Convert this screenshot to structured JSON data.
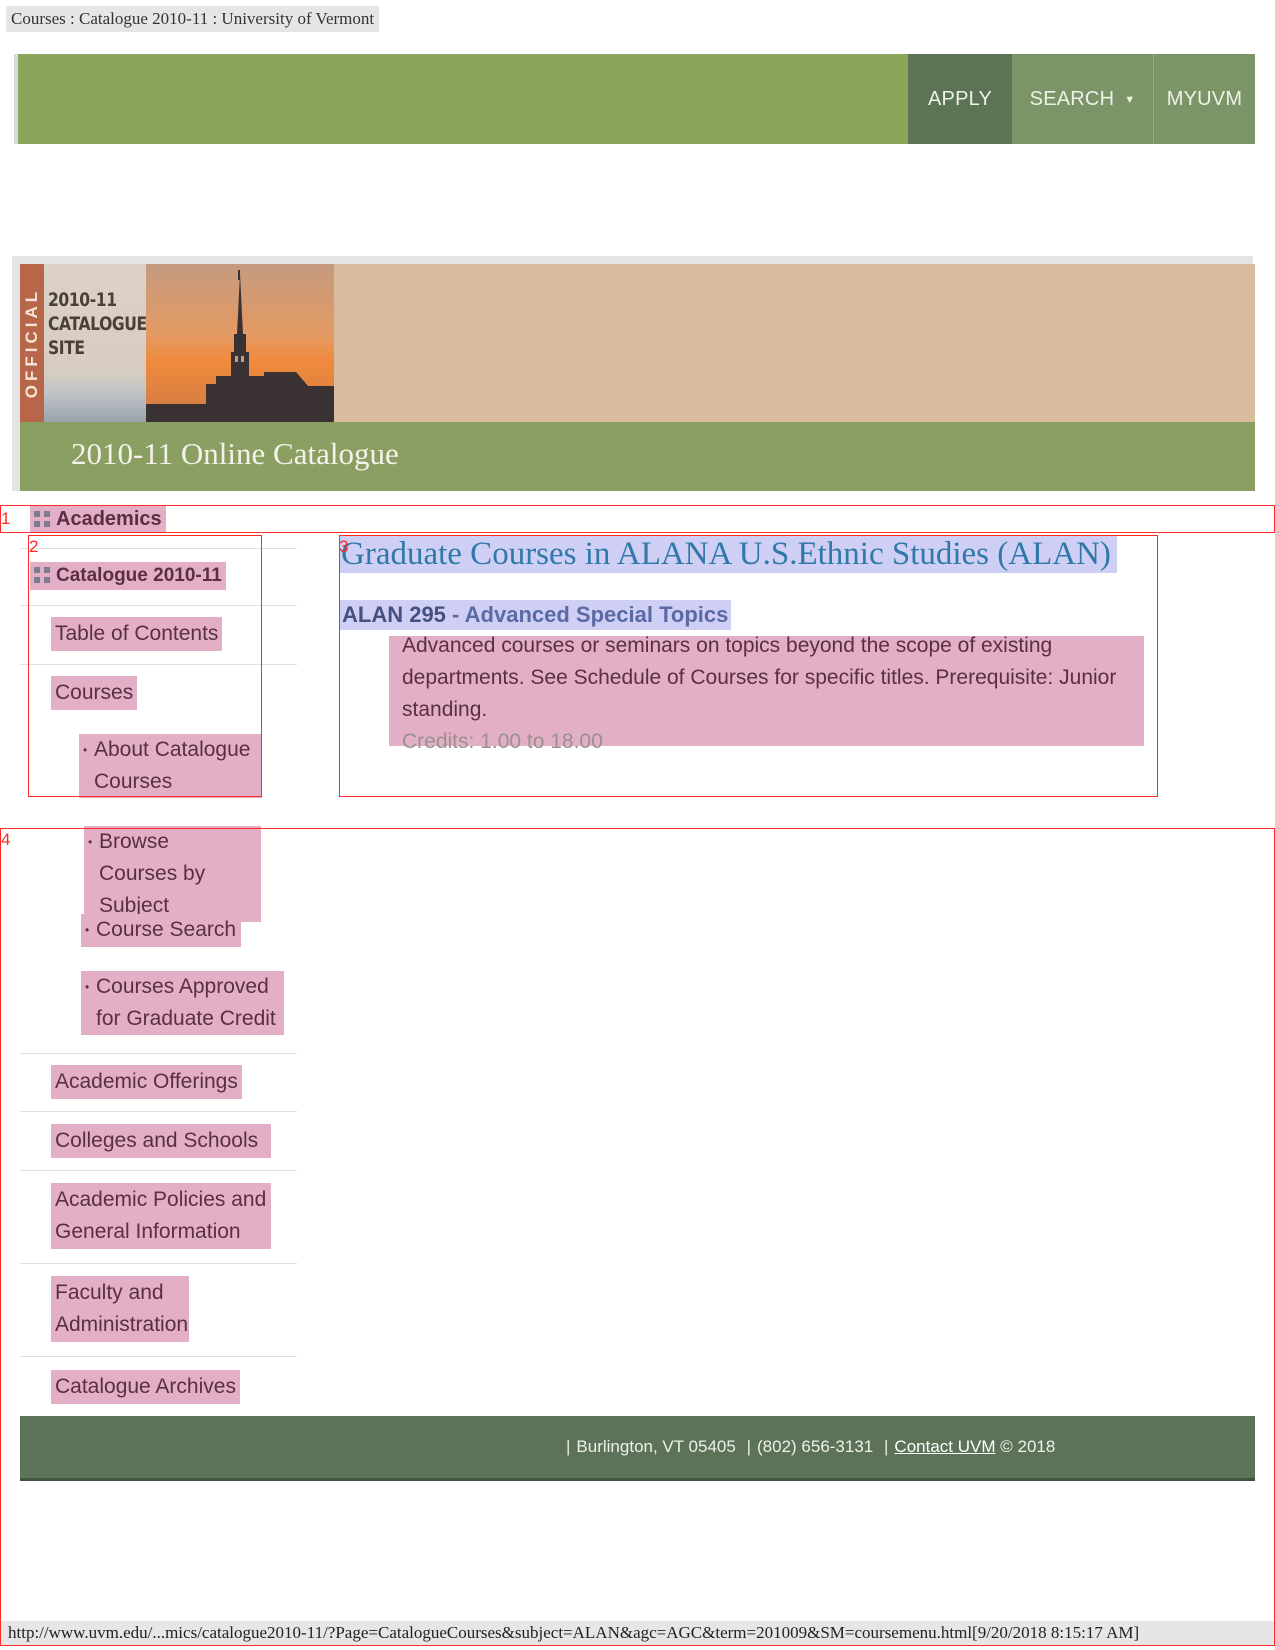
{
  "print": {
    "title": "Courses : Catalogue 2010-11 : University of Vermont",
    "url": "http://www.uvm.edu/...mics/catalogue2010-11/?Page=CatalogueCourses&subject=ALAN&agc=AGC&term=201009&SM=coursemenu.html[9/20/2018 8:15:17 AM]"
  },
  "topnav": {
    "apply": "APPLY",
    "search": "SEARCH",
    "myuvm": "MYUVM"
  },
  "banner": {
    "official": "OFFICIAL",
    "catalogue_site": [
      "2010-11",
      "CATALOGUE",
      "SITE"
    ],
    "title": "2010-11 Online Catalogue"
  },
  "sidebar": {
    "heading": "Academics",
    "subheading": "Catalogue 2010-11",
    "items": [
      "Table of Contents",
      "Courses",
      "Academic Offerings",
      "Colleges and Schools",
      "Academic Policies and General Information",
      "Faculty and Administration",
      "Catalogue Archives"
    ],
    "sub_items": [
      "About Catalogue Courses",
      "Browse Courses by Subject",
      "Course Search",
      "Courses Approved for Graduate Credit"
    ]
  },
  "main": {
    "heading": "Graduate Courses in ALANA U.S.Ethnic Studies (ALAN)",
    "course_code": "ALAN 295",
    "course_title": "- Advanced Special Topics",
    "description": "Advanced courses or seminars on topics beyond the scope of existing departments. See Schedule of Courses for specific titles. Prerequisite: Junior standing.",
    "credits": "Credits: 1.00 to 18.00"
  },
  "footer": {
    "address": "Burlington, VT 05405",
    "phone": "(802) 656-3131",
    "contact": "Contact UVM",
    "copyright": "© 2018"
  },
  "annotations": [
    "1",
    "2",
    "3",
    "4"
  ],
  "colors": {
    "nav_green": "#8ba65a",
    "apply_bg": "#5c7356",
    "highlight_pink": "#e2afc6",
    "highlight_lavender": "#cfcff6",
    "heading_blue": "#2f79a8",
    "footer_green": "#5c7358"
  }
}
